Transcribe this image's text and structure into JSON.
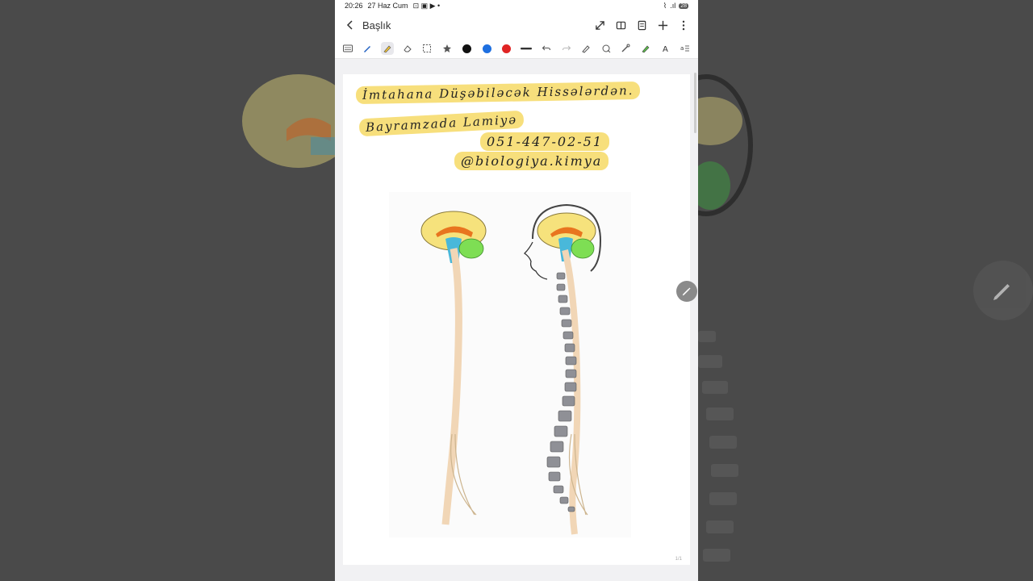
{
  "status": {
    "time": "20:26",
    "date": "27 Haz Cum",
    "battery": "28"
  },
  "header": {
    "title": "Başlık"
  },
  "toolbar": {
    "colors": [
      "#111111",
      "#1e6fe0",
      "#e02424"
    ]
  },
  "note": {
    "line1": "İmtahana Düşəbiləcək Hissələrdən.",
    "line2": "Bayramzada Lamiyə",
    "line3": "051-447-02-51",
    "line4": "@biologiya.kimya"
  },
  "page": {
    "number": "1/1"
  }
}
